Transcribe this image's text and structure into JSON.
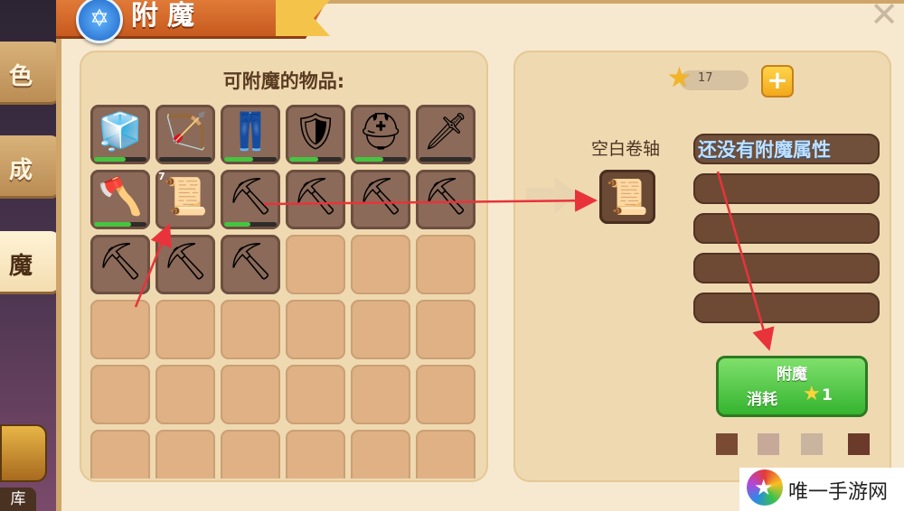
{
  "side_tabs": [
    {
      "label": "色",
      "active": false
    },
    {
      "label": "成",
      "active": false
    },
    {
      "label": "魔",
      "active": true
    }
  ],
  "storage_label": "库",
  "header": {
    "title": "附魔",
    "badge_icon": "star-of-david-icon",
    "close_icon": "close-icon"
  },
  "items_panel": {
    "title": "可附魔的物品:"
  },
  "inventory": [
    {
      "icon": "crystal-boots-icon",
      "glyph": "🧊",
      "durability": 0.6,
      "count": ""
    },
    {
      "icon": "bow-icon",
      "glyph": "🏹",
      "durability": 0,
      "count": ""
    },
    {
      "icon": "silver-leggings-icon",
      "glyph": "👖",
      "durability": 0.55,
      "count": ""
    },
    {
      "icon": "crystal-armor-icon",
      "glyph": "🛡",
      "durability": 0.55,
      "count": ""
    },
    {
      "icon": "iron-helmet-icon",
      "glyph": "⛑",
      "durability": 0.55,
      "count": ""
    },
    {
      "icon": "steel-sword-icon",
      "glyph": "🗡",
      "durability": 0,
      "count": ""
    },
    {
      "icon": "axe-icon",
      "glyph": "🪓",
      "durability": 0.7,
      "count": ""
    },
    {
      "icon": "blank-scroll-icon",
      "glyph": "📜",
      "durability": null,
      "count": "7"
    },
    {
      "icon": "shovel-icon",
      "glyph": "⛏",
      "durability": 0.5,
      "count": ""
    },
    {
      "icon": "pickaxe-icon",
      "glyph": "⛏",
      "durability": null,
      "count": ""
    },
    {
      "icon": "pickaxe-icon",
      "glyph": "⛏",
      "durability": null,
      "count": ""
    },
    {
      "icon": "pickaxe-icon",
      "glyph": "⛏",
      "durability": null,
      "count": ""
    },
    {
      "icon": "pickaxe-icon",
      "glyph": "⛏",
      "durability": null,
      "count": ""
    },
    {
      "icon": "pickaxe-icon",
      "glyph": "⛏",
      "durability": null,
      "count": ""
    },
    {
      "icon": "pickaxe-icon",
      "glyph": "⛏",
      "durability": null,
      "count": ""
    }
  ],
  "empty_slots": 21,
  "currency": {
    "star_count": "17",
    "plus_icon": "plus-icon"
  },
  "enchant_target": {
    "label": "空白卷轴",
    "icon": "blank-scroll-icon"
  },
  "attributes": [
    "还没有附魔属性",
    "",
    "",
    "",
    ""
  ],
  "enchant_button": {
    "title": "附魔",
    "cost_label": "消耗",
    "cost_value": "1"
  },
  "watermark": {
    "text": "唯一手游网"
  }
}
